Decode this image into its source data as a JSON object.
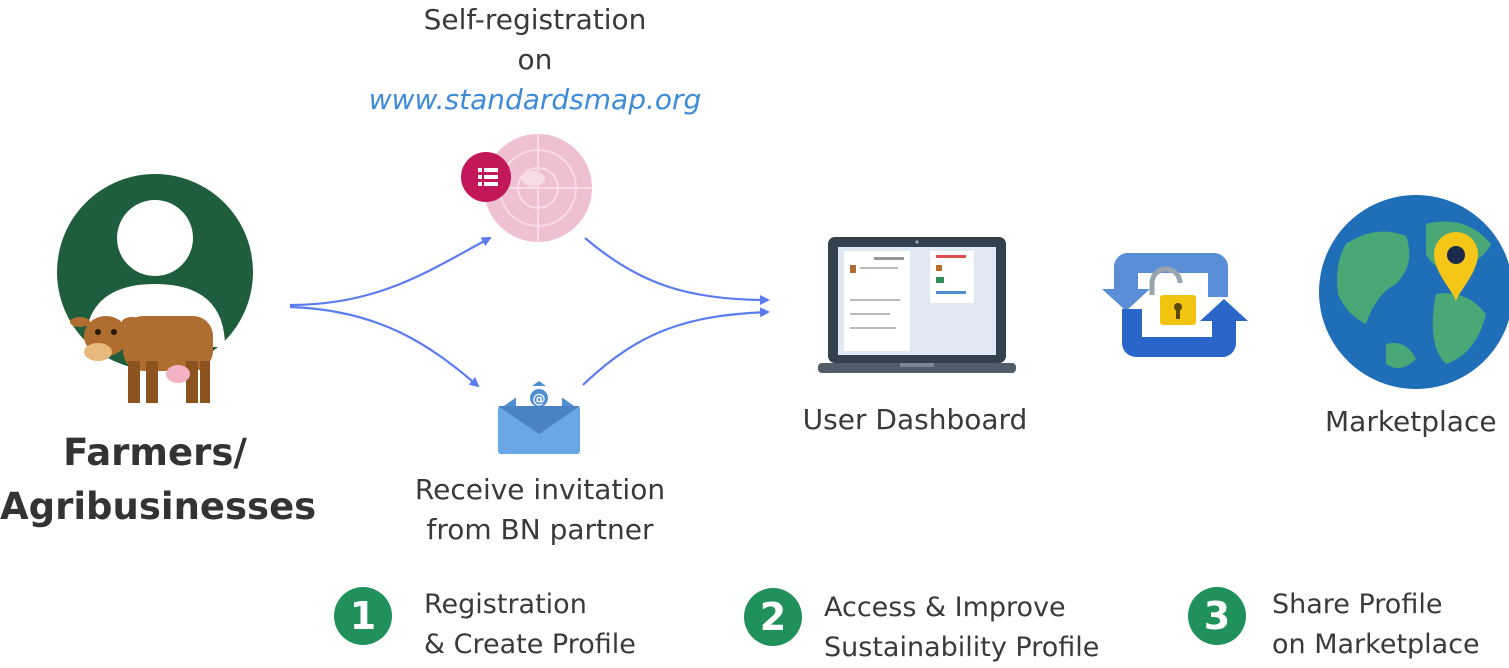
{
  "actor": {
    "line1": "Farmers/",
    "line2": "Agribusinesses"
  },
  "self_registration": {
    "line1": "Self-registration",
    "line2": "on",
    "link": "www.standardsmap.org"
  },
  "invitation": {
    "line1": "Receive invitation",
    "line2": "from BN partner"
  },
  "dashboard": {
    "label": "User Dashboard"
  },
  "marketplace": {
    "label": "Marketplace"
  },
  "steps": [
    {
      "number": "1",
      "line1": "Registration",
      "line2": "& Create Profile"
    },
    {
      "number": "2",
      "line1": "Access & Improve",
      "line2": "Sustainability Profile"
    },
    {
      "number": "3",
      "line1": "Share Profile",
      "line2": "on Marketplace"
    }
  ],
  "icons": {
    "person": "person-avatar-icon",
    "cow": "cow-icon",
    "globe_list": "globe-list-icon",
    "envelope": "envelope-icon",
    "laptop": "laptop-icon",
    "sync_lock": "sync-lock-icon",
    "earth": "earth-location-icon"
  },
  "colors": {
    "step_green": "#21915b",
    "link_blue": "#3d8bd9",
    "arrow_blue": "#5a7cf0",
    "avatar_green": "#1e5e3c"
  }
}
